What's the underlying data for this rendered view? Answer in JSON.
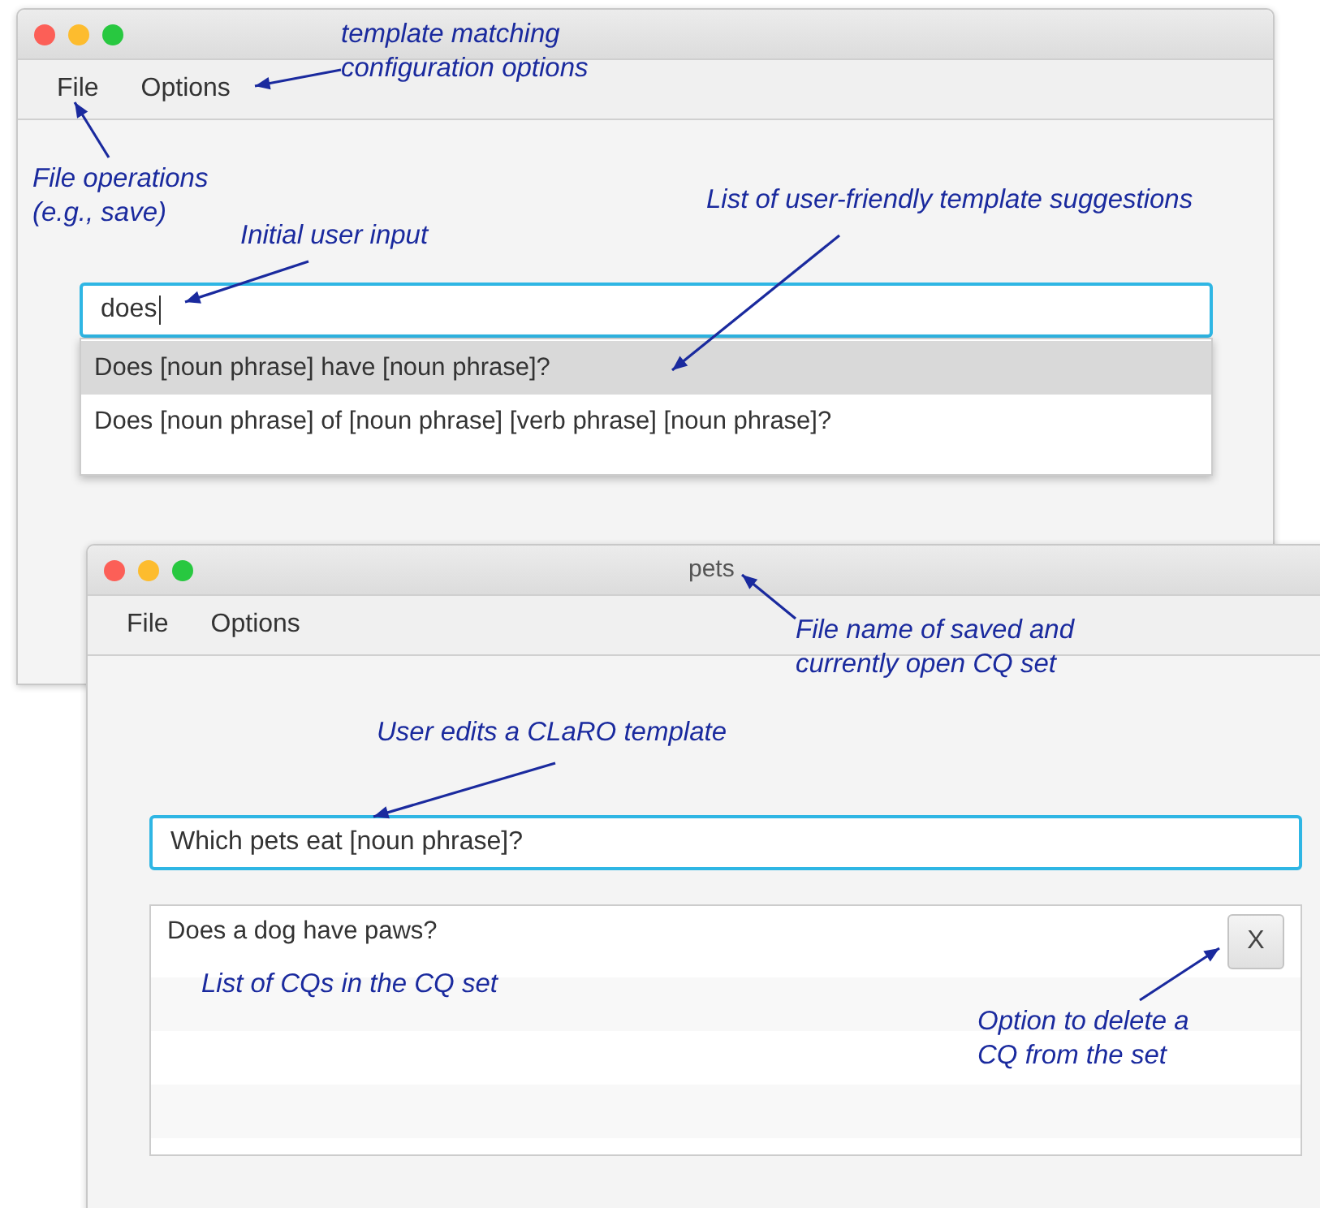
{
  "windows": [
    {
      "menu": [
        {
          "label": "File"
        },
        {
          "label": "Options"
        }
      ],
      "field": {
        "value": "does",
        "focused": true
      },
      "suggestions": [
        {
          "text": "Does [noun phrase] have [noun phrase]?",
          "selected": true
        },
        {
          "text": "Does [noun phrase] of [noun phrase] [verb phrase] [noun phrase]?",
          "selected": false
        }
      ]
    },
    {
      "title": "pets",
      "menu": [
        {
          "label": "File"
        },
        {
          "label": "Options"
        }
      ],
      "field": {
        "value": "Which pets eat [noun phrase]?",
        "focused": true
      },
      "cq_list": [
        {
          "text": "Does a dog have paws?",
          "delete_label": "X"
        }
      ]
    }
  ],
  "annotations": [
    {
      "lines": [
        "template matching",
        "configuration options"
      ]
    },
    {
      "lines": [
        "File operations",
        "(e.g., save)"
      ]
    },
    {
      "lines": [
        "Initial user input"
      ]
    },
    {
      "lines": [
        "List of user-friendly template suggestions"
      ]
    },
    {
      "lines": [
        "File name of saved and",
        "currently open CQ set"
      ]
    },
    {
      "lines": [
        "User edits a CLaRO template"
      ]
    },
    {
      "lines": [
        "List of CQs in the CQ set"
      ]
    },
    {
      "lines": [
        "Option to delete a",
        "CQ from the set"
      ]
    }
  ]
}
